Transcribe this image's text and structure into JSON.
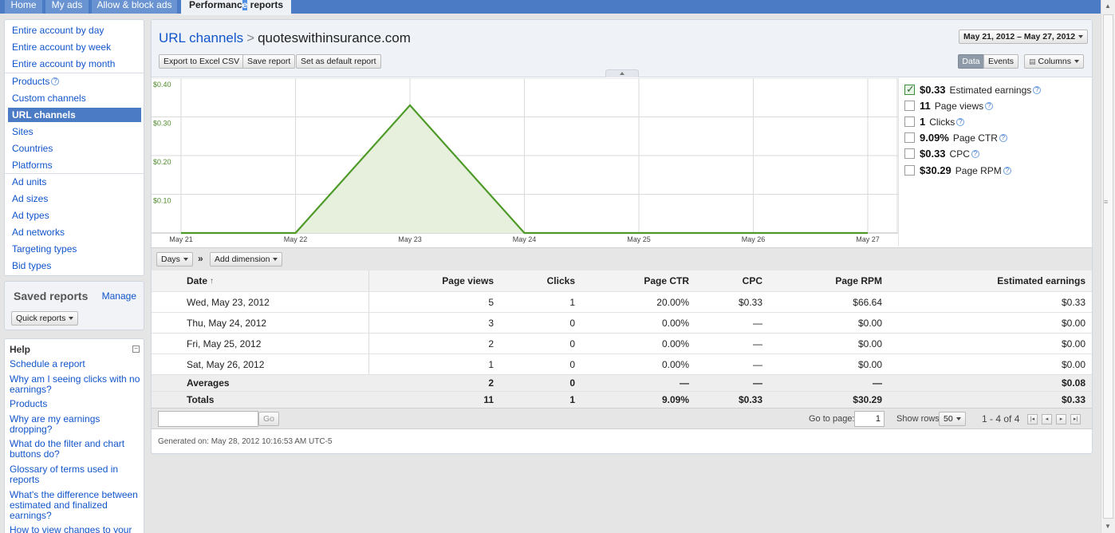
{
  "nav": {
    "tabs": [
      {
        "label": "Home"
      },
      {
        "label": "My ads"
      },
      {
        "label": "Allow & block ads"
      },
      {
        "label_pre": "Performanc",
        "label_hl": "e",
        "label_post": " reports"
      }
    ]
  },
  "sidebar": {
    "items": [
      "Entire account by day",
      "Entire account by week",
      "Entire account by month",
      "Products",
      "Custom channels",
      "URL channels",
      "Sites",
      "Countries",
      "Platforms",
      "Ad units",
      "Ad sizes",
      "Ad types",
      "Ad networks",
      "Targeting types",
      "Bid types"
    ],
    "selected": "URL channels"
  },
  "saved_reports": {
    "title": "Saved reports",
    "manage": "Manage",
    "quick_reports": "Quick reports"
  },
  "help": {
    "title": "Help",
    "links": [
      "Schedule a report",
      "Why am I seeing clicks with no earnings?",
      "Products",
      "Why are my earnings dropping?",
      "What do the filter and chart buttons do?",
      "Glossary of terms used in reports",
      "What's the difference between estimated and finalized earnings?",
      "How to view changes to your"
    ]
  },
  "header": {
    "crumb_parent": "URL channels",
    "crumb_sep": ">",
    "crumb_current": "quoteswithinsurance.com",
    "date_range": "May 21, 2012 – May 27, 2012",
    "export_label": "Export to Excel CSV",
    "save_label": "Save report",
    "default_label": "Set as default report",
    "data_label": "Data",
    "events_label": "Events",
    "columns_label": "Columns"
  },
  "chart_data": {
    "type": "area",
    "categories": [
      "May 21",
      "May 22",
      "May 23",
      "May 24",
      "May 25",
      "May 26",
      "May 27"
    ],
    "series": [
      {
        "name": "Estimated earnings",
        "values": [
          0,
          0,
          0.33,
          0,
          0,
          0,
          0
        ]
      }
    ],
    "ylim": [
      0,
      0.4
    ],
    "y_ticks": [
      "$0.40",
      "$0.30",
      "$0.20",
      "$0.10"
    ],
    "y_tick_values": [
      0.4,
      0.3,
      0.2,
      0.1
    ],
    "grid": true,
    "color": "#4d9a28",
    "fill": "#e6f0dd"
  },
  "metrics": [
    {
      "value": "$0.33",
      "label": "Estimated earnings",
      "checked": true
    },
    {
      "value": "11",
      "label": "Page views",
      "checked": false
    },
    {
      "value": "1",
      "label": "Clicks",
      "checked": false
    },
    {
      "value": "9.09%",
      "label": "Page CTR",
      "checked": false
    },
    {
      "value": "$0.33",
      "label": "CPC",
      "checked": false
    },
    {
      "value": "$30.29",
      "label": "Page RPM",
      "checked": false
    }
  ],
  "toolbar": {
    "days_label": "Days",
    "sep": "»",
    "add_dimension": "Add dimension"
  },
  "table": {
    "columns": [
      "Date",
      "Page views",
      "Clicks",
      "Page CTR",
      "CPC",
      "Page RPM",
      "Estimated earnings"
    ],
    "sort_arrow": "↑",
    "rows": [
      [
        "Wed, May 23, 2012",
        "5",
        "1",
        "20.00%",
        "$0.33",
        "$66.64",
        "$0.33"
      ],
      [
        "Thu, May 24, 2012",
        "3",
        "0",
        "0.00%",
        "—",
        "$0.00",
        "$0.00"
      ],
      [
        "Fri, May 25, 2012",
        "2",
        "0",
        "0.00%",
        "—",
        "$0.00",
        "$0.00"
      ],
      [
        "Sat, May 26, 2012",
        "1",
        "0",
        "0.00%",
        "—",
        "$0.00",
        "$0.00"
      ]
    ],
    "averages": [
      "Averages",
      "2",
      "0",
      "—",
      "—",
      "—",
      "$0.08"
    ],
    "totals": [
      "Totals",
      "11",
      "1",
      "9.09%",
      "$0.33",
      "$30.29",
      "$0.33"
    ]
  },
  "pager": {
    "go_label": "Go",
    "goto_label": "Go to page:",
    "page_value": "1",
    "show_rows_label": "Show rows:",
    "rows_value": "50",
    "range_text": "1 - 4 of 4"
  },
  "footer": {
    "generated": "Generated on: May 28, 2012 10:16:53 AM UTC-5"
  }
}
